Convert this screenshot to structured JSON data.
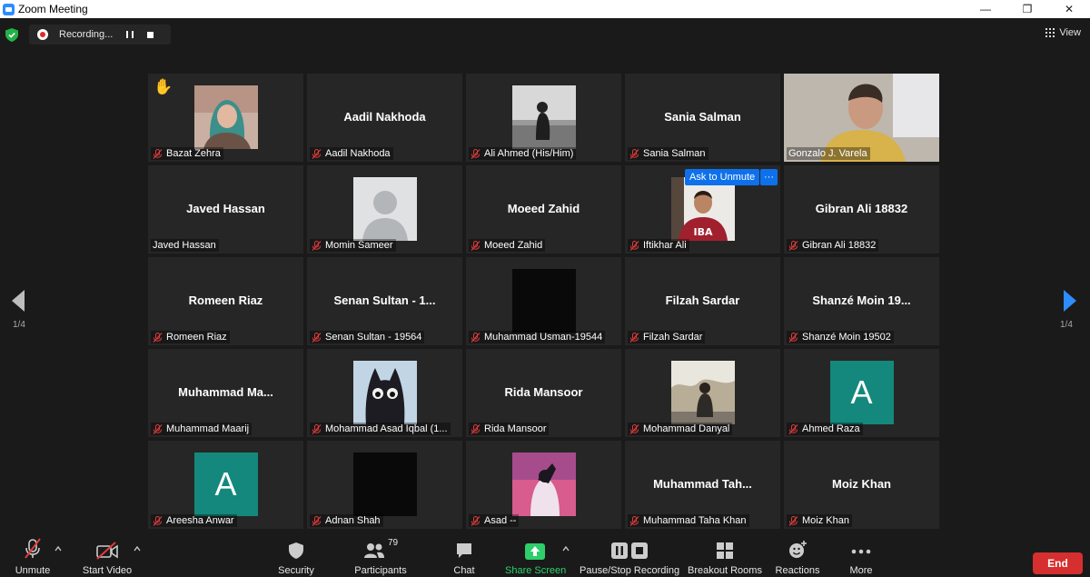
{
  "window": {
    "title": "Zoom Meeting"
  },
  "recording": {
    "status_label": "Recording..."
  },
  "view": {
    "label": "View"
  },
  "pagination": {
    "left": "1/4",
    "right": "1/4"
  },
  "ask_to_unmute": {
    "label": "Ask to Unmute",
    "more": "···"
  },
  "participants": [
    {
      "display": "",
      "name": "Bazat Zehra",
      "muted": true,
      "photo": "woman-selfie",
      "hand_raised": true
    },
    {
      "display": "Aadil Nakhoda",
      "name": "Aadil Nakhoda",
      "muted": true
    },
    {
      "display": "",
      "name": "Ali Ahmed (His/Him)",
      "muted": true,
      "photo": "grayscale-person"
    },
    {
      "display": "Sania Salman",
      "name": "Sania Salman",
      "muted": true
    },
    {
      "display": "",
      "name": "Gonzalo J. Varela",
      "muted": false,
      "photo": "video-feed",
      "active_speaker": true
    },
    {
      "display": "Javed Hassan",
      "name": "Javed Hassan",
      "muted": false
    },
    {
      "display": "",
      "name": "Momin Sameer",
      "muted": true,
      "photo": "default-avatar"
    },
    {
      "display": "Moeed Zahid",
      "name": "Moeed Zahid",
      "muted": true
    },
    {
      "display": "",
      "name": "Iftikhar Ali",
      "muted": true,
      "photo": "man-red-sweater"
    },
    {
      "display": "Gibran Ali 18832",
      "name": "Gibran Ali 18832",
      "muted": true
    },
    {
      "display": "Romeen Riaz",
      "name": "Romeen Riaz",
      "muted": true
    },
    {
      "display": "Senan Sultan - 1...",
      "name": "Senan Sultan - 19564",
      "muted": true
    },
    {
      "display": "",
      "name": "Muhammad Usman-19544",
      "muted": true,
      "photo": "black"
    },
    {
      "display": "Filzah Sardar",
      "name": "Filzah Sardar",
      "muted": true
    },
    {
      "display": "Shanzé Moin 19...",
      "name": "Shanzé Moin 19502",
      "muted": true
    },
    {
      "display": "Muhammad Ma...",
      "name": "Muhammad Maarij",
      "muted": true
    },
    {
      "display": "",
      "name": "Mohammad Asad Iqbal (1...",
      "muted": true,
      "photo": "black-cat"
    },
    {
      "display": "Rida Mansoor",
      "name": "Rida Mansoor",
      "muted": true
    },
    {
      "display": "",
      "name": "Mohammad Danyal",
      "muted": true,
      "photo": "outdoor-person"
    },
    {
      "display": "",
      "name": "Ahmed Raza",
      "muted": true,
      "letter": "A"
    },
    {
      "display": "",
      "name": "Areesha Anwar",
      "muted": true,
      "letter": "A"
    },
    {
      "display": "",
      "name": "Adnan Shah",
      "muted": true,
      "photo": "black"
    },
    {
      "display": "",
      "name": "Asad --",
      "muted": true,
      "photo": "pink-art"
    },
    {
      "display": "Muhammad Tah...",
      "name": "Muhammad Taha Khan",
      "muted": true
    },
    {
      "display": "Moiz Khan",
      "name": "Moiz Khan",
      "muted": true
    }
  ],
  "toolbar": {
    "unmute": "Unmute",
    "start_video": "Start Video",
    "security": "Security",
    "participants": "Participants",
    "participants_count": "79",
    "chat": "Chat",
    "share_screen": "Share Screen",
    "pause_stop_recording": "Pause/Stop Recording",
    "breakout_rooms": "Breakout Rooms",
    "reactions": "Reactions",
    "more": "More",
    "end": "End"
  },
  "colors": {
    "accent_blue": "#0e71eb",
    "share_green": "#2ecf6b",
    "end_red": "#d62f2f",
    "active_border": "#d8e86a",
    "letter_avatar": "#14887c"
  }
}
